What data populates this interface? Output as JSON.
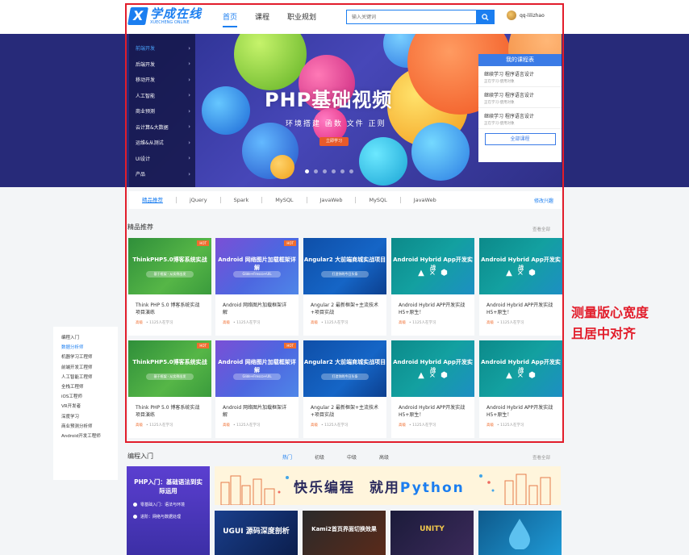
{
  "header": {
    "logo_mark": "X",
    "logo_title": "学成在线",
    "logo_sub": "XUECHENG ONLINE",
    "nav": [
      "首页",
      "课程",
      "职业规划"
    ],
    "search_placeholder": "输入关键词",
    "username": "qq-lilizhao"
  },
  "banner": {
    "title": "PHP基础视频",
    "subtitle": "环境搭建  函数  文件  正则",
    "button": "立即学习",
    "menu": [
      "前端开发",
      "后端开发",
      "移动开发",
      "人工智能",
      "商业预测",
      "云计算&大数据",
      "运维&从测试",
      "UI设计",
      "产品"
    ],
    "course_panel": {
      "header": "我的课程表",
      "items": [
        {
          "title": "继续学习  程序语言设计",
          "desc": "正在学习-使用对象"
        },
        {
          "title": "继续学习  程序语言设计",
          "desc": "正在学习-使用对象"
        },
        {
          "title": "继续学习  程序语言设计",
          "desc": "正在学习-使用对象"
        }
      ],
      "all_button": "全部课程"
    }
  },
  "tagbar": {
    "tags": [
      "精品推荐",
      "jQuery",
      "Spark",
      "MySQL",
      "JavaWeb",
      "MySQL",
      "JavaWeb"
    ],
    "more": "修改兴趣"
  },
  "recommend": {
    "title": "精品推荐",
    "more": "查看全部",
    "cards": [
      {
        "thumb": "ThinkPHP5.0博客系统实战",
        "thumb_sub": "基于框架 · 从实例出发",
        "title": "Think PHP 5.0 博客系统实战项目演练",
        "level": "高级",
        "learners": "1125人在学习"
      },
      {
        "thumb": "Android 网络图片加载框架详解",
        "thumb_sub": "Glide+Fresco+UIL",
        "title": "Android 网络图片加载框架详解",
        "level": "高级",
        "learners": "1125人在学习"
      },
      {
        "thumb": "Angular2 大前端商城实战项目",
        "thumb_sub": "打造你的今日头条",
        "title": "Angular 2 最新框架+主流技术+项目实战",
        "level": "高级",
        "learners": "1125人在学习"
      },
      {
        "thumb": "Android Hybrid App开发实战",
        "thumb_sub": "",
        "title": "Android Hybrid APP开发实战 H5+原生！",
        "level": "高级",
        "learners": "1125人在学习"
      },
      {
        "thumb": "Android Hybrid App开发实战",
        "thumb_sub": "",
        "title": "Android Hybrid APP开发实战 H5+原生！",
        "level": "高级",
        "learners": "1125人在学习"
      },
      {
        "thumb": "ThinkPHP5.0博客系统实战",
        "thumb_sub": "基于框架 · 从实例出发",
        "title": "Think PHP 5.0 博客系统实战项目演练",
        "level": "高级",
        "learners": "1125人在学习"
      },
      {
        "thumb": "Android 网络图片加载框架详解",
        "thumb_sub": "Glide+Fresco+UIL",
        "title": "Android 网络图片加载框架详解",
        "level": "高级",
        "learners": "1125人在学习"
      },
      {
        "thumb": "Angular2 大前端商城实战项目",
        "thumb_sub": "打造你的今日头条",
        "title": "Angular 2 最新框架+主流技术+项目实战",
        "level": "高级",
        "learners": "1125人在学习"
      },
      {
        "thumb": "Android Hybrid App开发实战",
        "thumb_sub": "",
        "title": "Android Hybrid APP开发实战 H5+原生！",
        "level": "高级",
        "learners": "1125人在学习"
      },
      {
        "thumb": "Android Hybrid App开发实战",
        "thumb_sub": "",
        "title": "Android Hybrid APP开发实战 H5+原生！",
        "level": "高级",
        "learners": "1125人在学习"
      }
    ],
    "new_label": "HOT"
  },
  "annotation": [
    "测量版心宽度",
    "且居中对齐"
  ],
  "float_list": [
    "编程入门",
    "数据分析师",
    "机器学习工程师",
    "前端开发工程师",
    "人工智能工程师",
    "全栈工程师",
    "iOS工程师",
    "VR开发者",
    "深度学习",
    "商业预测分析师",
    "Android开发工程师"
  ],
  "bottom": {
    "title": "编程入门",
    "more": "查看全部",
    "tabs": [
      "热门",
      "初级",
      "中级",
      "高级"
    ],
    "promo_title": "PHP入门：基础语法到实际运用",
    "promo_lines": [
      "零基础入门：语法与环境",
      "进阶：网络与数据处理"
    ],
    "python_banner": [
      "快乐编程",
      "就用",
      "Python"
    ],
    "minis": [
      "UGUI 源码深度剖析",
      "Kami2首页界面切换效果",
      "UNITY",
      ""
    ]
  },
  "colors": {
    "brand": "#1b7ef0",
    "highlight": "#e21d2b",
    "banner_bg": "#272a79"
  }
}
